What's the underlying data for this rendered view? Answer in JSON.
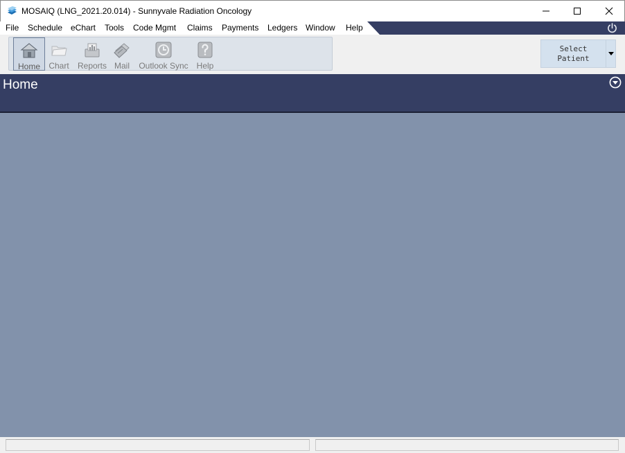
{
  "window": {
    "title": "MOSAIQ (LNG_2021.20.014) - Sunnyvale Radiation Oncology",
    "icons": {
      "app": "mosaiq-app-icon",
      "minimize": "minimize-icon",
      "maximize": "maximize-icon",
      "close": "close-icon"
    }
  },
  "menu": {
    "items": [
      "File",
      "Schedule",
      "eChart",
      "Tools",
      "Code Mgmt",
      "Claims",
      "Payments",
      "Ledgers",
      "Window",
      "Help"
    ],
    "power_icon": "power-icon"
  },
  "toolbar": {
    "buttons": [
      {
        "label": "Home",
        "icon": "home-icon",
        "active": true
      },
      {
        "label": "Chart",
        "icon": "chart-folder-icon",
        "enabled": false
      },
      {
        "label": "Reports",
        "icon": "reports-icon",
        "enabled": false
      },
      {
        "label": "Mail",
        "icon": "mail-icon",
        "enabled": false
      },
      {
        "label": "Outlook Sync",
        "icon": "outlook-sync-icon",
        "enabled": false
      },
      {
        "label": "Help",
        "icon": "help-icon",
        "enabled": false
      }
    ],
    "select_patient": {
      "line1": "Select",
      "line2": "Patient",
      "dropdown_icon": "dropdown-arrow-icon"
    }
  },
  "header": {
    "title": "Home",
    "collapse_icon": "collapse-icon"
  },
  "status_bar": {
    "left": "",
    "right": ""
  },
  "colors": {
    "header_band": "#353e63",
    "workspace": "#8292ab",
    "toolbar_panel": "#dde3ea",
    "select_patient_bg": "#d4e1ee"
  }
}
